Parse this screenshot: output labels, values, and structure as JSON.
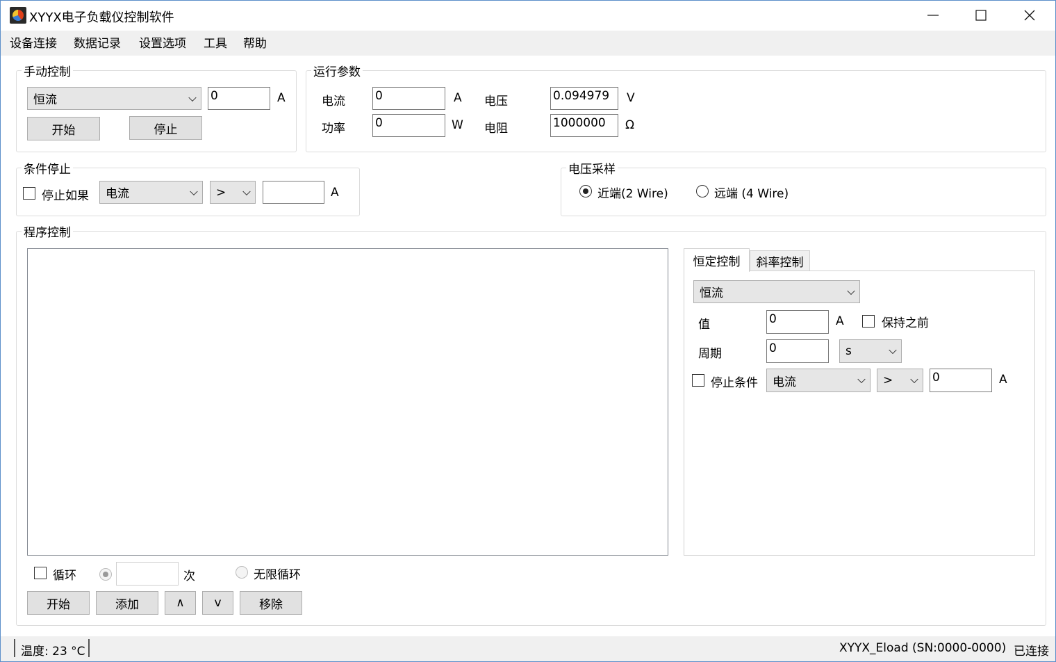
{
  "window": {
    "title": "XYYX电子负载仪控制软件",
    "minimize_icon": "minimize-icon",
    "maximize_icon": "maximize-icon",
    "close_icon": "close-icon"
  },
  "menu": [
    "设备连接",
    "数据记录",
    "设置选项",
    "工具",
    "帮助"
  ],
  "manual": {
    "title": "手动控制",
    "mode": "恒流",
    "value": "0",
    "unit": "A",
    "start": "开始",
    "stop": "停止"
  },
  "runtime": {
    "title": "运行参数",
    "current_label": "电流",
    "current_value": "0",
    "current_unit": "A",
    "power_label": "功率",
    "power_value": "0",
    "power_unit": "W",
    "voltage_label": "电压",
    "voltage_value": "0.094979",
    "voltage_unit": "V",
    "resistance_label": "电阻",
    "resistance_value": "1000000",
    "resistance_unit": "Ω"
  },
  "cond_stop": {
    "title": "条件停止",
    "checkbox_label": "停止如果",
    "param": "电流",
    "op": ">",
    "value": "",
    "unit": "A"
  },
  "sampling": {
    "title": "电压采样",
    "near": "近端(2 Wire)",
    "far": "远端 (4 Wire)",
    "selected": "near"
  },
  "program": {
    "title": "程序控制",
    "tabs": [
      "恒定控制",
      "斜率控制"
    ],
    "active_tab": 0,
    "mode": "恒流",
    "value_label": "值",
    "value": "0",
    "value_unit": "A",
    "keep_prev_label": "保持之前",
    "period_label": "周期",
    "period": "0",
    "period_unit": "s",
    "stop_label": "停止条件",
    "stop_param": "电流",
    "stop_op": ">",
    "stop_value": "0",
    "stop_unit": "A",
    "loop_label": "循环",
    "times_value": "",
    "times_unit": "次",
    "infinite_label": "无限循环",
    "btn_start": "开始",
    "btn_add": "添加",
    "btn_up": "∧",
    "btn_down": "v",
    "btn_remove": "移除"
  },
  "status": {
    "temperature": "温度: 23 °C",
    "device": "XYYX_Eload (SN:0000-0000)",
    "connection": "已连接"
  }
}
